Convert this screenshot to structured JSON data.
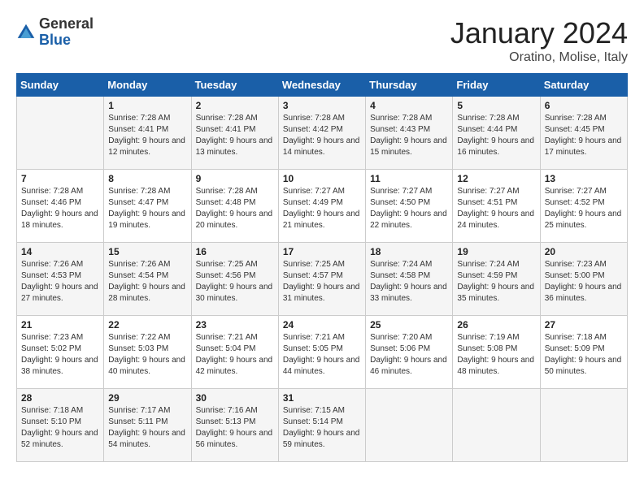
{
  "logo": {
    "general": "General",
    "blue": "Blue"
  },
  "header": {
    "month": "January 2024",
    "location": "Oratino, Molise, Italy"
  },
  "days_of_week": [
    "Sunday",
    "Monday",
    "Tuesday",
    "Wednesday",
    "Thursday",
    "Friday",
    "Saturday"
  ],
  "weeks": [
    [
      {
        "day": "",
        "sunrise": "",
        "sunset": "",
        "daylight": ""
      },
      {
        "day": "1",
        "sunrise": "Sunrise: 7:28 AM",
        "sunset": "Sunset: 4:41 PM",
        "daylight": "Daylight: 9 hours and 12 minutes."
      },
      {
        "day": "2",
        "sunrise": "Sunrise: 7:28 AM",
        "sunset": "Sunset: 4:41 PM",
        "daylight": "Daylight: 9 hours and 13 minutes."
      },
      {
        "day": "3",
        "sunrise": "Sunrise: 7:28 AM",
        "sunset": "Sunset: 4:42 PM",
        "daylight": "Daylight: 9 hours and 14 minutes."
      },
      {
        "day": "4",
        "sunrise": "Sunrise: 7:28 AM",
        "sunset": "Sunset: 4:43 PM",
        "daylight": "Daylight: 9 hours and 15 minutes."
      },
      {
        "day": "5",
        "sunrise": "Sunrise: 7:28 AM",
        "sunset": "Sunset: 4:44 PM",
        "daylight": "Daylight: 9 hours and 16 minutes."
      },
      {
        "day": "6",
        "sunrise": "Sunrise: 7:28 AM",
        "sunset": "Sunset: 4:45 PM",
        "daylight": "Daylight: 9 hours and 17 minutes."
      }
    ],
    [
      {
        "day": "7",
        "sunrise": "Sunrise: 7:28 AM",
        "sunset": "Sunset: 4:46 PM",
        "daylight": "Daylight: 9 hours and 18 minutes."
      },
      {
        "day": "8",
        "sunrise": "Sunrise: 7:28 AM",
        "sunset": "Sunset: 4:47 PM",
        "daylight": "Daylight: 9 hours and 19 minutes."
      },
      {
        "day": "9",
        "sunrise": "Sunrise: 7:28 AM",
        "sunset": "Sunset: 4:48 PM",
        "daylight": "Daylight: 9 hours and 20 minutes."
      },
      {
        "day": "10",
        "sunrise": "Sunrise: 7:27 AM",
        "sunset": "Sunset: 4:49 PM",
        "daylight": "Daylight: 9 hours and 21 minutes."
      },
      {
        "day": "11",
        "sunrise": "Sunrise: 7:27 AM",
        "sunset": "Sunset: 4:50 PM",
        "daylight": "Daylight: 9 hours and 22 minutes."
      },
      {
        "day": "12",
        "sunrise": "Sunrise: 7:27 AM",
        "sunset": "Sunset: 4:51 PM",
        "daylight": "Daylight: 9 hours and 24 minutes."
      },
      {
        "day": "13",
        "sunrise": "Sunrise: 7:27 AM",
        "sunset": "Sunset: 4:52 PM",
        "daylight": "Daylight: 9 hours and 25 minutes."
      }
    ],
    [
      {
        "day": "14",
        "sunrise": "Sunrise: 7:26 AM",
        "sunset": "Sunset: 4:53 PM",
        "daylight": "Daylight: 9 hours and 27 minutes."
      },
      {
        "day": "15",
        "sunrise": "Sunrise: 7:26 AM",
        "sunset": "Sunset: 4:54 PM",
        "daylight": "Daylight: 9 hours and 28 minutes."
      },
      {
        "day": "16",
        "sunrise": "Sunrise: 7:25 AM",
        "sunset": "Sunset: 4:56 PM",
        "daylight": "Daylight: 9 hours and 30 minutes."
      },
      {
        "day": "17",
        "sunrise": "Sunrise: 7:25 AM",
        "sunset": "Sunset: 4:57 PM",
        "daylight": "Daylight: 9 hours and 31 minutes."
      },
      {
        "day": "18",
        "sunrise": "Sunrise: 7:24 AM",
        "sunset": "Sunset: 4:58 PM",
        "daylight": "Daylight: 9 hours and 33 minutes."
      },
      {
        "day": "19",
        "sunrise": "Sunrise: 7:24 AM",
        "sunset": "Sunset: 4:59 PM",
        "daylight": "Daylight: 9 hours and 35 minutes."
      },
      {
        "day": "20",
        "sunrise": "Sunrise: 7:23 AM",
        "sunset": "Sunset: 5:00 PM",
        "daylight": "Daylight: 9 hours and 36 minutes."
      }
    ],
    [
      {
        "day": "21",
        "sunrise": "Sunrise: 7:23 AM",
        "sunset": "Sunset: 5:02 PM",
        "daylight": "Daylight: 9 hours and 38 minutes."
      },
      {
        "day": "22",
        "sunrise": "Sunrise: 7:22 AM",
        "sunset": "Sunset: 5:03 PM",
        "daylight": "Daylight: 9 hours and 40 minutes."
      },
      {
        "day": "23",
        "sunrise": "Sunrise: 7:21 AM",
        "sunset": "Sunset: 5:04 PM",
        "daylight": "Daylight: 9 hours and 42 minutes."
      },
      {
        "day": "24",
        "sunrise": "Sunrise: 7:21 AM",
        "sunset": "Sunset: 5:05 PM",
        "daylight": "Daylight: 9 hours and 44 minutes."
      },
      {
        "day": "25",
        "sunrise": "Sunrise: 7:20 AM",
        "sunset": "Sunset: 5:06 PM",
        "daylight": "Daylight: 9 hours and 46 minutes."
      },
      {
        "day": "26",
        "sunrise": "Sunrise: 7:19 AM",
        "sunset": "Sunset: 5:08 PM",
        "daylight": "Daylight: 9 hours and 48 minutes."
      },
      {
        "day": "27",
        "sunrise": "Sunrise: 7:18 AM",
        "sunset": "Sunset: 5:09 PM",
        "daylight": "Daylight: 9 hours and 50 minutes."
      }
    ],
    [
      {
        "day": "28",
        "sunrise": "Sunrise: 7:18 AM",
        "sunset": "Sunset: 5:10 PM",
        "daylight": "Daylight: 9 hours and 52 minutes."
      },
      {
        "day": "29",
        "sunrise": "Sunrise: 7:17 AM",
        "sunset": "Sunset: 5:11 PM",
        "daylight": "Daylight: 9 hours and 54 minutes."
      },
      {
        "day": "30",
        "sunrise": "Sunrise: 7:16 AM",
        "sunset": "Sunset: 5:13 PM",
        "daylight": "Daylight: 9 hours and 56 minutes."
      },
      {
        "day": "31",
        "sunrise": "Sunrise: 7:15 AM",
        "sunset": "Sunset: 5:14 PM",
        "daylight": "Daylight: 9 hours and 59 minutes."
      },
      {
        "day": "",
        "sunrise": "",
        "sunset": "",
        "daylight": ""
      },
      {
        "day": "",
        "sunrise": "",
        "sunset": "",
        "daylight": ""
      },
      {
        "day": "",
        "sunrise": "",
        "sunset": "",
        "daylight": ""
      }
    ]
  ]
}
